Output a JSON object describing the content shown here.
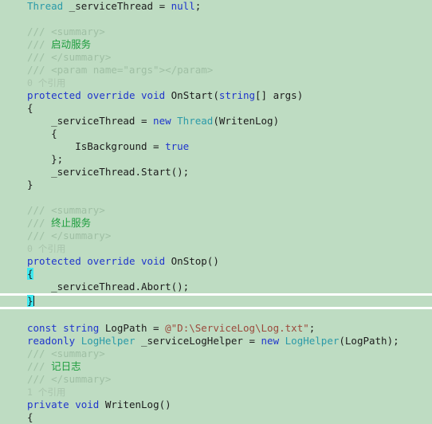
{
  "editor": {
    "language": "csharp",
    "background_color": "#bedcc2",
    "current_line_highlight_color": "#ffffff",
    "brace_match_highlight_color": "#3fe8ef",
    "colors": {
      "keyword": "#1f35cc",
      "type": "#2b9aa8",
      "string": "#9b4a3c",
      "comment": "#9fbfa4",
      "comment_cjk": "#1d9d3d",
      "codelens": "#a8c4ac",
      "plain": "#1c1c1c"
    }
  },
  "code": {
    "l1": {
      "type": "Thread",
      "name": " _serviceThread = ",
      "null": "null",
      "semi": ";"
    },
    "l3_summary_open": "/// <summary>",
    "l4_slashes": "/// ",
    "l4_cn": "启动服务",
    "l5_summary_close": "/// </summary>",
    "l6_param": "/// <param name=\"args\"></param>",
    "l7_codelens": "0 个引用",
    "l8": {
      "kw1": "protected",
      "sp1": " ",
      "kw2": "override",
      "sp2": " ",
      "kw3": "void",
      "sp3": " ",
      "name": "OnStart(",
      "kw4": "string",
      "rest": "[] args)"
    },
    "l9_open_brace": "{",
    "l10": {
      "lhs": "    _serviceThread = ",
      "kw_new": "new",
      "sp": " ",
      "type": "Thread",
      "rest": "(WritenLog)"
    },
    "l11_brace": "    {",
    "l12": {
      "prop": "        IsBackground = ",
      "kw_true": "true"
    },
    "l13_brace_semi": "    };",
    "l14_start": "    _serviceThread.Start();",
    "l15_close_brace": "}",
    "l17_summary_open": "/// <summary>",
    "l18_slashes": "/// ",
    "l18_cn": "终止服务",
    "l19_summary_close": "/// </summary>",
    "l20_codelens": "0 个引用",
    "l21": {
      "kw1": "protected",
      "sp1": " ",
      "kw2": "override",
      "sp2": " ",
      "kw3": "void",
      "sp3": " ",
      "name": "OnStop()"
    },
    "l22_open_brace": "{",
    "l23_abort": "    _serviceThread.Abort();",
    "l24_close_brace": "}",
    "l26": {
      "kw_const": "const",
      "sp1": " ",
      "kw_string": "string",
      "mid": " LogPath = ",
      "str": "@\"D:\\ServiceLog\\Log.txt\"",
      "semi": ";"
    },
    "l27": {
      "kw_readonly": "readonly",
      "sp1": " ",
      "type1": "LogHelper",
      "mid": " _serviceLogHelper = ",
      "kw_new": "new",
      "sp2": " ",
      "type2": "LogHelper",
      "rest": "(LogPath);"
    },
    "l28_summary_open": "/// <summary>",
    "l29_slashes": "/// ",
    "l29_cn": "记日志",
    "l30_summary_close": "/// </summary>",
    "l31_codelens": "1 个引用",
    "l32": {
      "kw1": "private",
      "sp1": " ",
      "kw2": "void",
      "sp2": " ",
      "name": "WritenLog()"
    },
    "l33_open_brace": "{"
  }
}
